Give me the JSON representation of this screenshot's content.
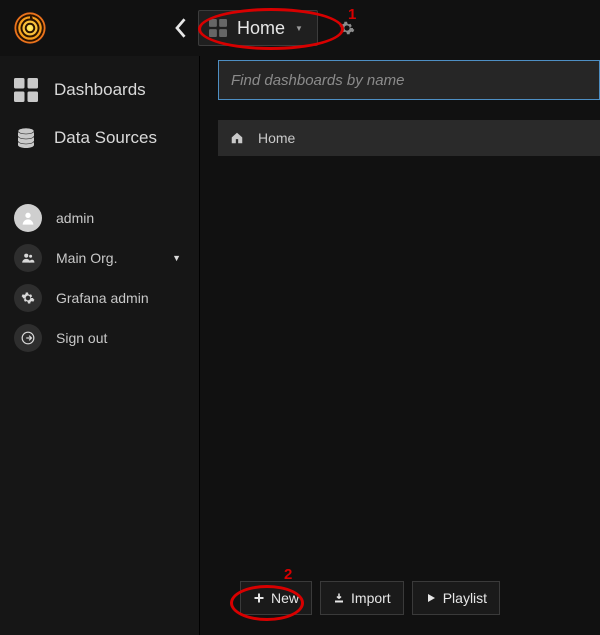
{
  "header": {
    "title": "Home"
  },
  "sidebar": {
    "primary": [
      {
        "label": "Dashboards"
      },
      {
        "label": "Data Sources"
      }
    ],
    "secondary": [
      {
        "label": "admin"
      },
      {
        "label": "Main Org."
      },
      {
        "label": "Grafana admin"
      },
      {
        "label": "Sign out"
      }
    ]
  },
  "search": {
    "placeholder": "Find dashboards by name"
  },
  "breadcrumb": {
    "label": "Home"
  },
  "buttons": {
    "new": "New",
    "import": "Import",
    "playlist": "Playlist"
  },
  "annotations": {
    "a1": "1",
    "a2": "2"
  }
}
